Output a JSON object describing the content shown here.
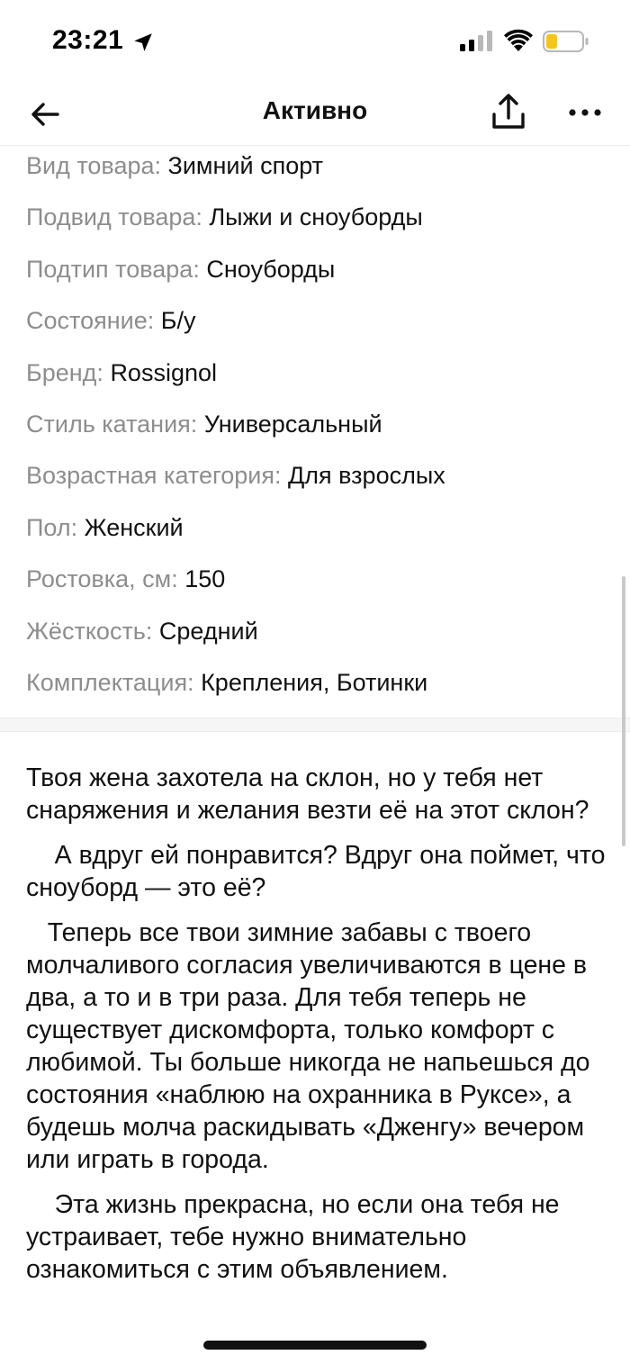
{
  "status_bar": {
    "time": "23:21",
    "icons": [
      "location-arrow-icon",
      "cellular-signal-icon",
      "wifi-icon",
      "battery-low-icon"
    ],
    "battery_color": "#f5c518"
  },
  "nav": {
    "title": "Активно",
    "back_icon": "arrow-left-icon",
    "share_icon": "share-icon",
    "more_icon": "more-horizontal-icon"
  },
  "attributes": [
    {
      "label": "Вид товара:",
      "value": "Зимний спорт"
    },
    {
      "label": "Подвид товара:",
      "value": "Лыжи и сноуборды"
    },
    {
      "label": "Подтип товара:",
      "value": "Сноуборды"
    },
    {
      "label": "Состояние:",
      "value": "Б/у"
    },
    {
      "label": "Бренд:",
      "value": "Rossignol"
    },
    {
      "label": "Стиль катания:",
      "value": "Универсальный"
    },
    {
      "label": "Возрастная категория:",
      "value": "Для взрослых"
    },
    {
      "label": "Пол:",
      "value": "Женский"
    },
    {
      "label": "Ростовка, см:",
      "value": "150"
    },
    {
      "label": "Жёсткость:",
      "value": "Средний"
    },
    {
      "label": "Комплектация:",
      "value": "Крепления, Ботинки"
    }
  ],
  "description": {
    "paragraphs": [
      "Твоя жена захотела на склон, но у тебя нет снаряжения и желания везти её на этот склон?",
      "    А вдруг ей понравится? Вдруг она поймет, что сноуборд — это её?",
      "   Теперь все твои зимние забавы с твоего молчаливого согласия увеличиваются в цене в два, а то и в три раза. Для тебя теперь не существует дискомфорта, только комфорт с любимой. Ты больше никогда не напьешься до состояния «наблюю на охранника в Руксе», а будешь молча раскидывать «Дженгу» вечером или играть в города.",
      "    Эта жизнь прекрасна, но если она тебя не устраивает, тебе нужно внимательно ознакомиться с этим объявлением."
    ]
  },
  "colors": {
    "label_gray": "#8d8d8d",
    "text": "#111111",
    "divider": "#f6f6f6"
  }
}
